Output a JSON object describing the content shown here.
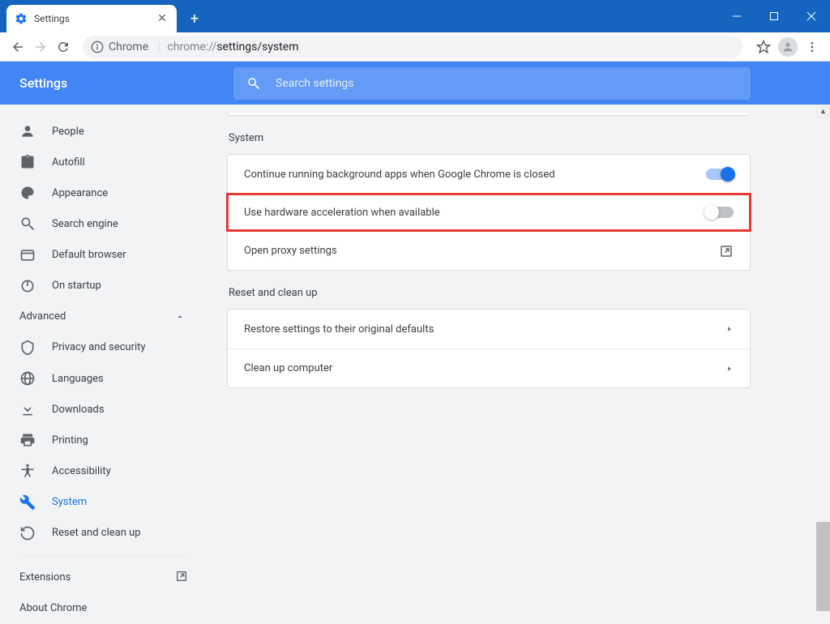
{
  "window": {
    "tab_title": "Settings",
    "url_prefix": "chrome://",
    "url_path_gray": "settings/",
    "url_path_dark": "system",
    "chrome_label": "Chrome"
  },
  "header": {
    "title": "Settings",
    "search_placeholder": "Search settings"
  },
  "sidebar": {
    "items": [
      {
        "label": "People",
        "icon": "person-icon"
      },
      {
        "label": "Autofill",
        "icon": "clipboard-icon"
      },
      {
        "label": "Appearance",
        "icon": "palette-icon"
      },
      {
        "label": "Search engine",
        "icon": "search-icon"
      },
      {
        "label": "Default browser",
        "icon": "browser-icon"
      },
      {
        "label": "On startup",
        "icon": "power-icon"
      }
    ],
    "advanced_label": "Advanced",
    "advanced_items": [
      {
        "label": "Privacy and security",
        "icon": "shield-icon"
      },
      {
        "label": "Languages",
        "icon": "globe-icon"
      },
      {
        "label": "Downloads",
        "icon": "download-icon"
      },
      {
        "label": "Printing",
        "icon": "print-icon"
      },
      {
        "label": "Accessibility",
        "icon": "accessibility-icon"
      },
      {
        "label": "System",
        "icon": "wrench-icon",
        "active": true
      },
      {
        "label": "Reset and clean up",
        "icon": "history-icon"
      }
    ],
    "extensions_label": "Extensions",
    "about_label": "About Chrome"
  },
  "content": {
    "section1_title": "System",
    "row_bg_apps": "Continue running background apps when Google Chrome is closed",
    "row_hw_accel": "Use hardware acceleration when available",
    "row_proxy": "Open proxy settings",
    "section2_title": "Reset and clean up",
    "row_restore": "Restore settings to their original defaults",
    "row_cleanup": "Clean up computer"
  },
  "colors": {
    "titlebar": "#1565c0",
    "header_blue": "#4285f4",
    "accent": "#1a73e8",
    "highlight": "#e53935"
  }
}
